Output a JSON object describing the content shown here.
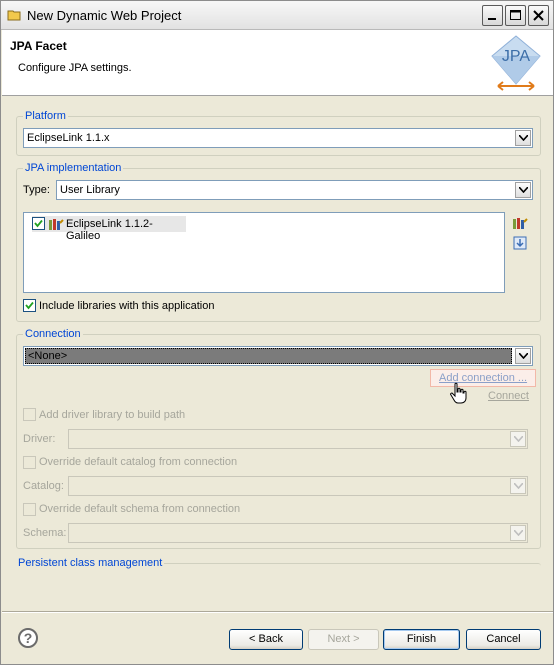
{
  "window": {
    "title": "New Dynamic Web Project"
  },
  "header": {
    "title": "JPA Facet",
    "description": "Configure JPA settings.",
    "logo_text": "JPA"
  },
  "platform": {
    "group_label": "Platform",
    "selected": "EclipseLink 1.1.x"
  },
  "jpa_implementation": {
    "group_label": "JPA implementation",
    "type_label": "Type:",
    "type_value": "User Library",
    "libraries": [
      {
        "name": "EclipseLink 1.1.2-Galileo",
        "checked": true
      }
    ],
    "include_libraries_label": "Include libraries with this application"
  },
  "connection": {
    "group_label": "Connection",
    "selected": "<None>",
    "add_connection_label": "Add connection ...",
    "connect_label": "Connect",
    "add_driver_label": "Add driver library to build path",
    "driver_label": "Driver:",
    "override_catalog_label": "Override default catalog from connection",
    "catalog_label": "Catalog:",
    "override_schema_label": "Override default schema from connection",
    "schema_label": "Schema:"
  },
  "persistent": {
    "group_label": "Persistent class management"
  },
  "buttons": {
    "back": "< Back",
    "next": "Next >",
    "finish": "Finish",
    "cancel": "Cancel"
  },
  "colors": {
    "group_label": "#0046d5",
    "dialog_bg": "#ece9d8",
    "selection": "#7b7b7b"
  }
}
